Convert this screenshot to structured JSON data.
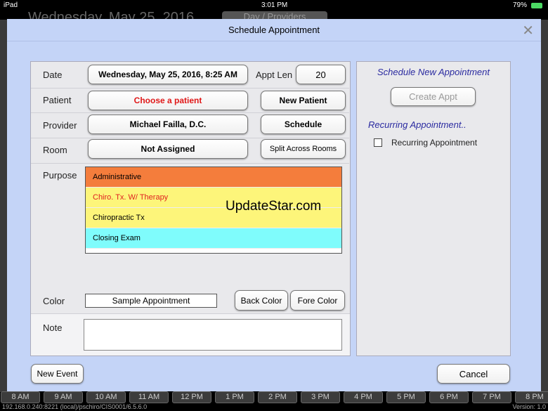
{
  "status_bar": {
    "device": "iPad",
    "time": "3:01 PM",
    "battery": "79%"
  },
  "background": {
    "date": "Wednesday, May 25, 2016",
    "view_button": "Day / Providers"
  },
  "modal": {
    "title": "Schedule Appointment",
    "form": {
      "date_label": "Date",
      "date_value": "Wednesday, May 25, 2016, 8:25 AM",
      "appt_len_label": "Appt Len",
      "appt_len_value": "20",
      "patient_label": "Patient",
      "patient_value": "Choose a patient",
      "new_patient": "New Patient",
      "provider_label": "Provider",
      "provider_value": "Michael Failla, D.C.",
      "schedule": "Schedule",
      "room_label": "Room",
      "room_value": "Not Assigned",
      "split_rooms": "Split Across Rooms",
      "purpose_label": "Purpose",
      "purposes": [
        {
          "label": "Administrative",
          "bg": "#f47d3c",
          "fg": "#000"
        },
        {
          "label": "Chiro. Tx. W/ Therapy",
          "bg": "#fdf57a",
          "fg": "#e02020"
        },
        {
          "label": "Chiropractic Tx",
          "bg": "#fdf57a",
          "fg": "#000"
        },
        {
          "label": "Closing Exam",
          "bg": "#7ffcfc",
          "fg": "#000"
        }
      ],
      "watermark": "UpdateStar.com",
      "color_label": "Color",
      "color_sample": "Sample Appointment",
      "back_color": "Back Color",
      "fore_color": "Fore Color",
      "note_label": "Note",
      "note_value": ""
    },
    "right": {
      "heading": "Schedule New Appointment",
      "create_appt": "Create Appt",
      "recurring_heading": "Recurring Appointment..",
      "recurring_checkbox": "Recurring Appointment"
    },
    "new_event": "New Event",
    "cancel": "Cancel"
  },
  "time_bar": [
    "8 AM",
    "9 AM",
    "10 AM",
    "11 AM",
    "12 PM",
    "1 PM",
    "2 PM",
    "3 PM",
    "4 PM",
    "5 PM",
    "6 PM",
    "7 PM",
    "8 PM"
  ],
  "footer": {
    "connection": "192.168.0.240:8221 (local)/pschiro/CIS0001/6.5.6.0",
    "version": "Version: 1.0"
  }
}
